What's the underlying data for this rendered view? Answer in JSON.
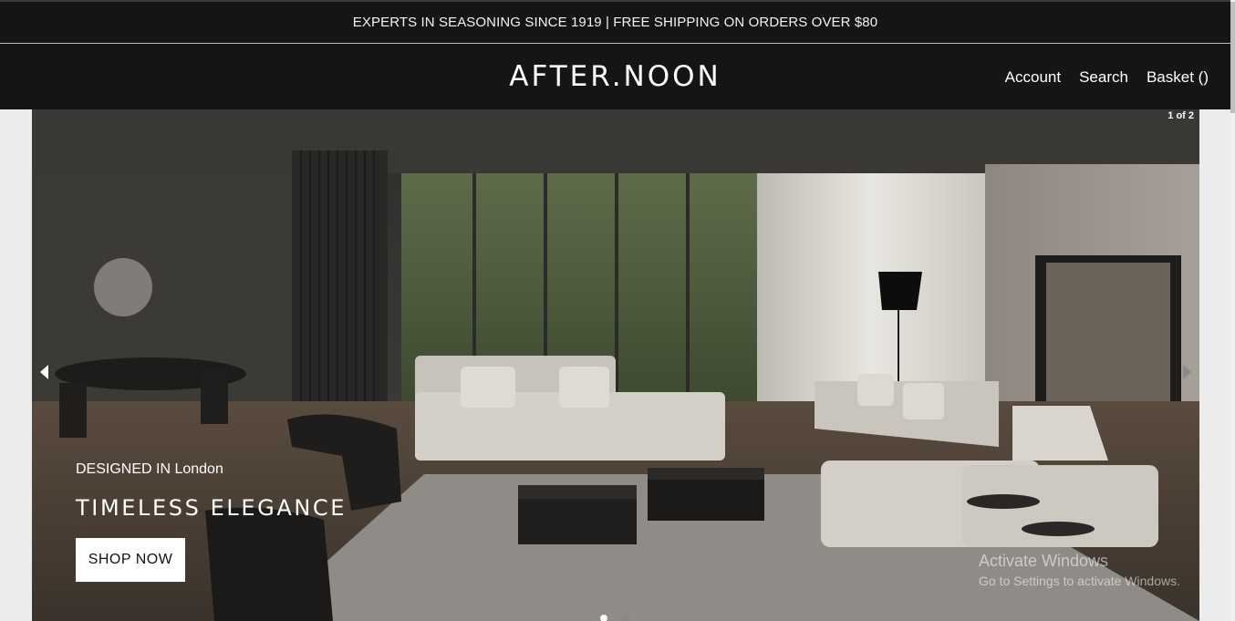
{
  "announcement": {
    "text": "EXPERTS IN SEASONING SINCE 1919 | FREE SHIPPING ON ORDERS OVER $80"
  },
  "header": {
    "logo": "AFTER.NOON",
    "nav": {
      "account": "Account",
      "search": "Search",
      "basket": "Basket ()"
    }
  },
  "hero": {
    "counter": "1 of 2",
    "subtitle": "DESIGNED IN London",
    "title": "TIMELESS ELEGANCE",
    "button": "SHOP NOW",
    "slide_count": 2,
    "active_slide": 1
  },
  "watermark": {
    "title": "Activate Windows",
    "subtitle": "Go to Settings to activate Windows."
  },
  "colors": {
    "header_bg": "#151515",
    "text_light": "#ffffff"
  }
}
